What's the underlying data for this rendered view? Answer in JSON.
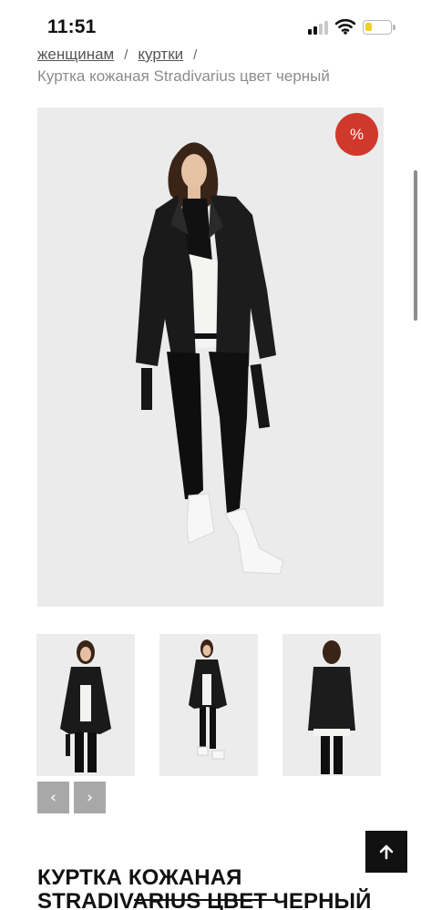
{
  "status_bar": {
    "time": "11:51",
    "battery_level": 0.25,
    "battery_color": "#f5cc2f"
  },
  "breadcrumb": {
    "items": [
      "женщинам",
      "куртки"
    ],
    "separator": "/",
    "current": "Куртка кожаная Stradivarius цвет черный"
  },
  "main_image": {
    "badge": "%",
    "badge_color": "#d0382b"
  },
  "gallery": {
    "thumbnail_count": 3,
    "prev_icon": "chevron-left-icon",
    "next_icon": "chevron-right-icon"
  },
  "back_to_top": {
    "icon": "arrow-up-icon"
  },
  "product": {
    "title": "Куртка кожаная Stradivarius цвет черный"
  }
}
